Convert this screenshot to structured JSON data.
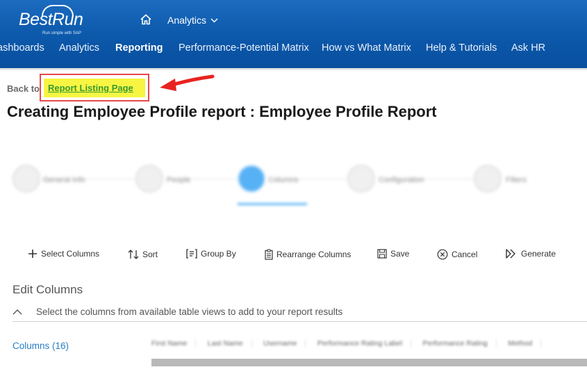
{
  "header": {
    "logo_text": "BestRun",
    "logo_tagline": "Run simple with SAP",
    "top_menu_label": "Analytics",
    "nav_items": [
      {
        "label": "ashboards"
      },
      {
        "label": "Analytics"
      },
      {
        "label": "Reporting"
      },
      {
        "label": "Performance-Potential Matrix"
      },
      {
        "label": "How vs What Matrix"
      },
      {
        "label": "Help & Tutorials"
      },
      {
        "label": "Ask HR"
      }
    ],
    "active_nav": "Reporting"
  },
  "back": {
    "prefix": "Back to:",
    "link_label": "Report Listing Page"
  },
  "page_title": "Creating Employee Profile report : Employee Profile Report",
  "stepper": {
    "steps": [
      {
        "label": "General Info"
      },
      {
        "label": "People"
      },
      {
        "label": "Columns"
      },
      {
        "label": "Configuration"
      },
      {
        "label": "Filters"
      }
    ],
    "active_step": "Columns"
  },
  "toolbar": {
    "select_columns": "Select Columns",
    "sort": "Sort",
    "group_by": "Group By",
    "rearrange_columns": "Rearrange Columns",
    "save": "Save",
    "cancel": "Cancel",
    "generate": "Generate"
  },
  "edit_columns": {
    "title": "Edit Columns",
    "description": "Select the columns from available table views to add to your report results",
    "columns_link": "Columns (16)",
    "column_headers": [
      "First Name",
      "Last Name",
      "Username",
      "Performance Rating Label",
      "Performance Rating",
      "Method"
    ]
  },
  "colors": {
    "header_blue": "#0c58aa",
    "highlight_yellow": "#f7f542",
    "annotation_red": "#e8484a",
    "link_green": "#3a9a2f",
    "link_blue": "#2a7ec4",
    "stepper_active": "#3aa4f4"
  },
  "icons": [
    "home-icon",
    "chevron-down-icon",
    "plus-icon",
    "sort-icon",
    "group-by-icon",
    "clipboard-icon",
    "save-icon",
    "cancel-icon",
    "generate-icon",
    "chevron-up-icon",
    "red-arrow-annotation"
  ]
}
